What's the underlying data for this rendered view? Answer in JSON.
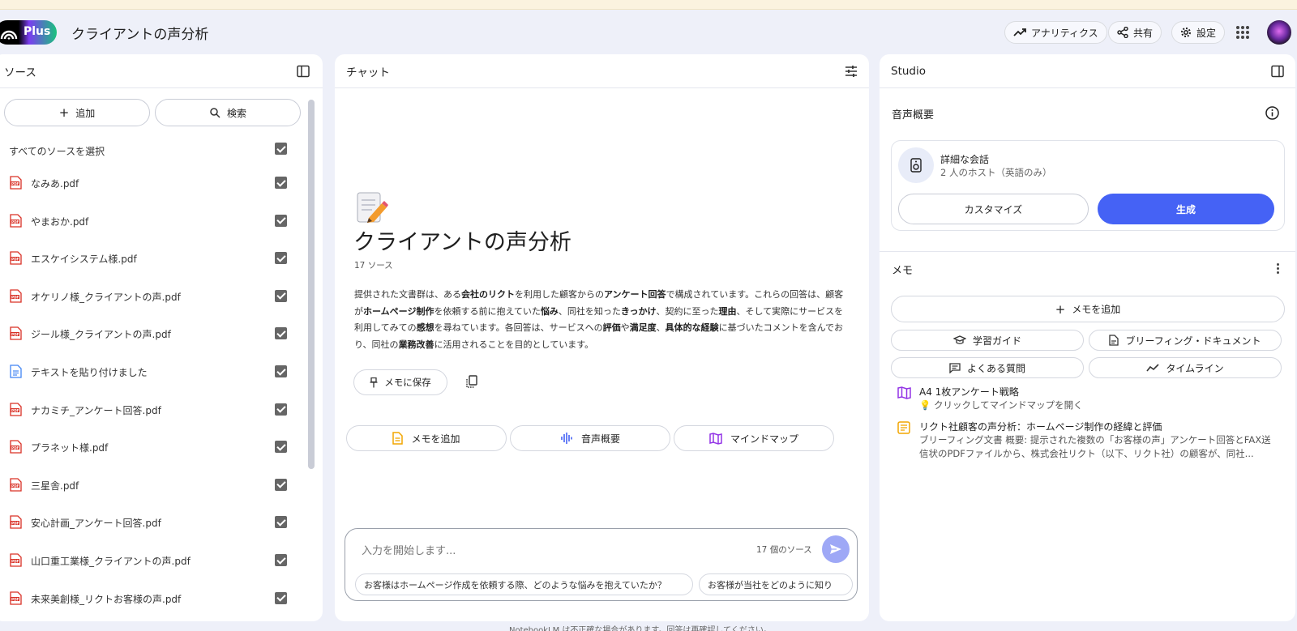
{
  "header": {
    "plan_label": "Plus",
    "notebook_title": "クライアントの声分析",
    "analytics_label": "アナリティクス",
    "share_label": "共有",
    "settings_label": "設定"
  },
  "sources": {
    "title": "ソース",
    "add_label": "追加",
    "search_label": "検索",
    "select_all_label": "すべてのソースを選択",
    "items": [
      {
        "name": "なみあ.pdf",
        "type": "pdf"
      },
      {
        "name": "やまおか.pdf",
        "type": "pdf"
      },
      {
        "name": "エスケイシステム様.pdf",
        "type": "pdf"
      },
      {
        "name": "オケリノ様_クライアントの声.pdf",
        "type": "pdf"
      },
      {
        "name": "ジール様_クライアントの声.pdf",
        "type": "pdf"
      },
      {
        "name": "テキストを貼り付けました",
        "type": "text"
      },
      {
        "name": "ナカミチ_アンケート回答.pdf",
        "type": "pdf"
      },
      {
        "name": "プラネット様.pdf",
        "type": "pdf"
      },
      {
        "name": "三星舎.pdf",
        "type": "pdf"
      },
      {
        "name": "安心計画_アンケート回答.pdf",
        "type": "pdf"
      },
      {
        "name": "山口重工業様_クライアントの声.pdf",
        "type": "pdf"
      },
      {
        "name": "未来美創様_リクトお客様の声.pdf",
        "type": "pdf"
      }
    ]
  },
  "chat": {
    "title": "チャット",
    "notebook_title": "クライアントの声分析",
    "source_count": "17 ソース",
    "summary_parts": [
      {
        "t": "提供された文書群は、ある",
        "b": false
      },
      {
        "t": "会社のリクト",
        "b": true
      },
      {
        "t": "を利用した顧客からの",
        "b": false
      },
      {
        "t": "アンケート回答",
        "b": true
      },
      {
        "t": "で構成されています。これらの回答は、顧客が",
        "b": false
      },
      {
        "t": "ホームページ制作",
        "b": true
      },
      {
        "t": "を依頼する前に抱えていた",
        "b": false
      },
      {
        "t": "悩み",
        "b": true
      },
      {
        "t": "、同社を知った",
        "b": false
      },
      {
        "t": "きっかけ",
        "b": true
      },
      {
        "t": "、契約に至った",
        "b": false
      },
      {
        "t": "理由",
        "b": true
      },
      {
        "t": "、そして実際にサービスを利用してみての",
        "b": false
      },
      {
        "t": "感想",
        "b": true
      },
      {
        "t": "を尋ねています。各回答は、サービスへの",
        "b": false
      },
      {
        "t": "評価",
        "b": true
      },
      {
        "t": "や",
        "b": false
      },
      {
        "t": "満足度",
        "b": true
      },
      {
        "t": "、",
        "b": false
      },
      {
        "t": "具体的な経験",
        "b": true
      },
      {
        "t": "に基づいたコメントを含んでおり、同社の",
        "b": false
      },
      {
        "t": "業務改善",
        "b": true
      },
      {
        "t": "に活用されることを目的としています。",
        "b": false
      }
    ],
    "save_memo_label": "メモに保存",
    "actions": [
      "メモを追加",
      "音声概要",
      "マインドマップ"
    ],
    "input_placeholder": "入力を開始します...",
    "input_source_count": "17 個のソース",
    "suggestions": [
      "お客様はホームページ作成を依頼する際、どのような悩みを抱えていたか？",
      "お客様が当社をどのように知り"
    ],
    "disclaimer": "NotebookLM は不正確な場合があります。回答は再確認してください。"
  },
  "studio": {
    "title": "Studio",
    "audio_section_title": "音声概要",
    "audio_card_title": "詳細な会話",
    "audio_card_sub": "2 人のホスト（英語のみ）",
    "customize_label": "カスタマイズ",
    "generate_label": "生成",
    "memo_section_title": "メモ",
    "add_memo_label": "メモを追加",
    "tools": [
      "学習ガイド",
      "ブリーフィング・ドキュメント",
      "よくある質問",
      "タイムライン"
    ],
    "notes": [
      {
        "title": "A4 1枚アンケート戦略",
        "sub": "💡 クリックしてマインドマップを開く",
        "icon": "mindmap-icon"
      },
      {
        "title": "リクト社顧客の声分析：ホームページ制作の経緯と評価",
        "sub": "ブリーフィング文書 概要: 提示された複数の「お客様の声」アンケート回答とFAX送信状のPDFファイルから、株式会社リクト（以下、リクト社）の顧客が、同社...",
        "icon": "note-icon"
      }
    ]
  },
  "colors": {
    "accent": "#4562f5",
    "background": "#eef0f9",
    "pdf_red": "#d93025",
    "doc_blue": "#4285f4",
    "note_yellow": "#f2a600",
    "mindmap_purple": "#9334e6"
  }
}
